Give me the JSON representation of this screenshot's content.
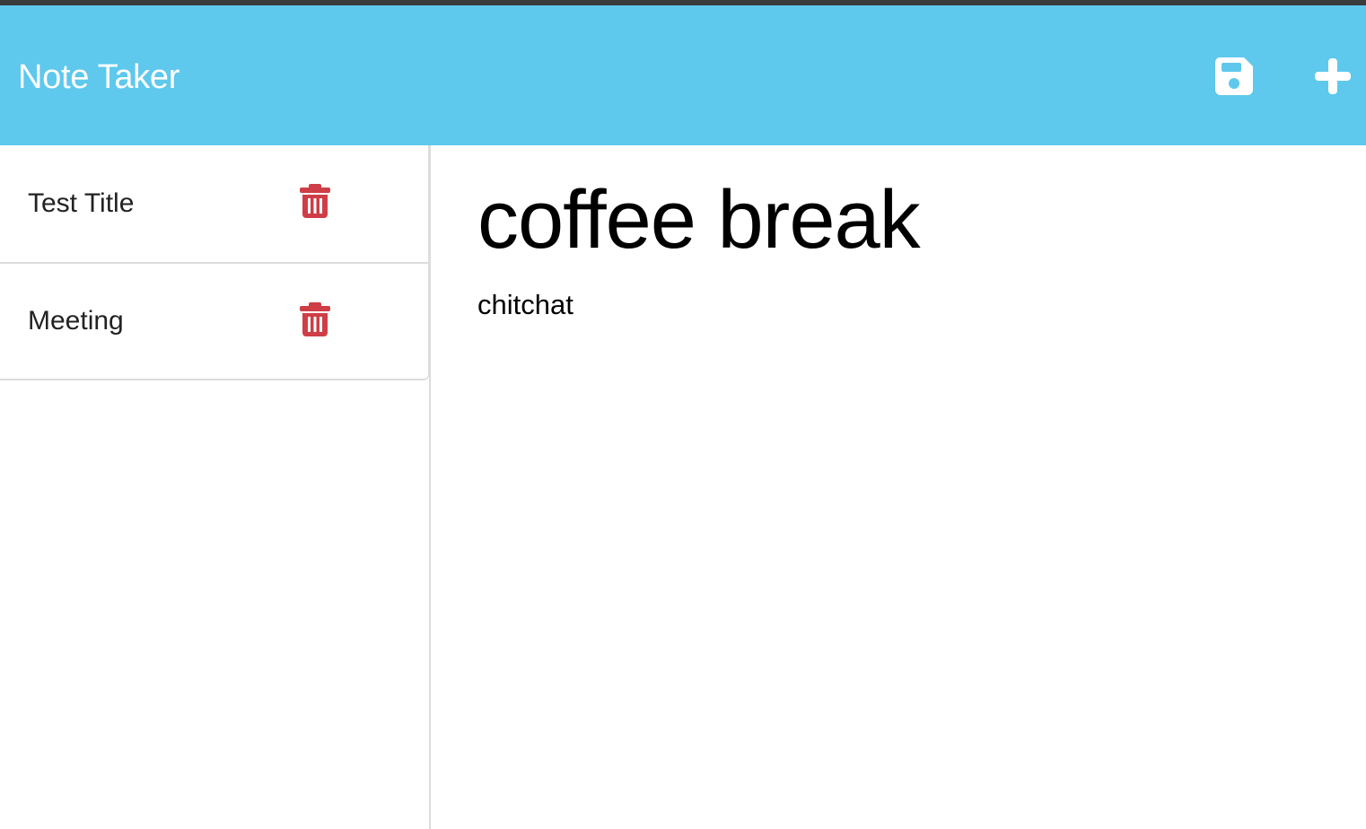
{
  "app": {
    "title": "Note Taker",
    "colors": {
      "navbar": "#5ec8ed",
      "delete": "#cf3e46",
      "icon": "#ffffff"
    }
  },
  "toolbar": {
    "save_icon": "save-icon",
    "new_icon": "plus-icon"
  },
  "notes": [
    {
      "title": "Test Title",
      "icon": "trash-icon"
    },
    {
      "title": "Meeting",
      "icon": "trash-icon"
    }
  ],
  "editor": {
    "title_value": "coffee break",
    "body_value": "chitchat"
  }
}
